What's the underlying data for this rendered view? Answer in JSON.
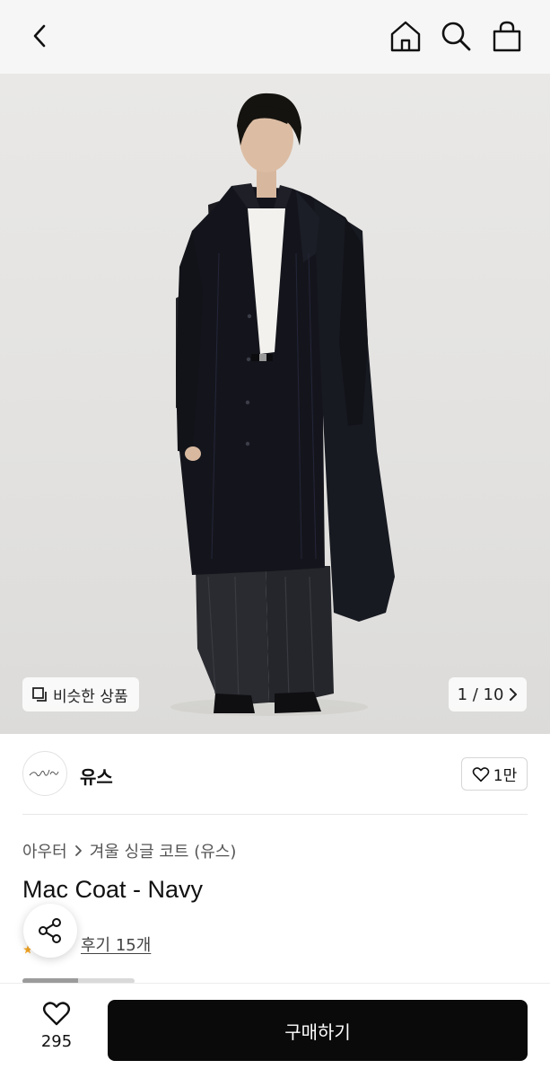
{
  "nav": {
    "back_icon": "chevron-left-icon",
    "home_icon": "home-icon",
    "search_icon": "search-icon",
    "bag_icon": "shopping-bag-icon"
  },
  "gallery": {
    "similar_label": "비슷한 상품",
    "similar_icon": "copy-squares-icon",
    "pager_text": "1 / 10",
    "pager_icon": "chevron-right-icon"
  },
  "brand": {
    "name": "유스",
    "logo_text": "youth",
    "favorite_count": "1만",
    "favorite_icon": "heart-outline-icon"
  },
  "product": {
    "breadcrumb": [
      "아우터",
      "겨울 싱글 코트 (유스)"
    ],
    "title": "Mac Coat - Navy",
    "reviews_label": "후기 15개",
    "share_icon": "share-icon"
  },
  "bottom": {
    "like_count": "295",
    "buy_label": "구매하기"
  },
  "colors": {
    "accent": "#0a0a0a",
    "background": "#ffffff",
    "hero_bg": "#e6e5e3",
    "coat": "#14151c"
  }
}
